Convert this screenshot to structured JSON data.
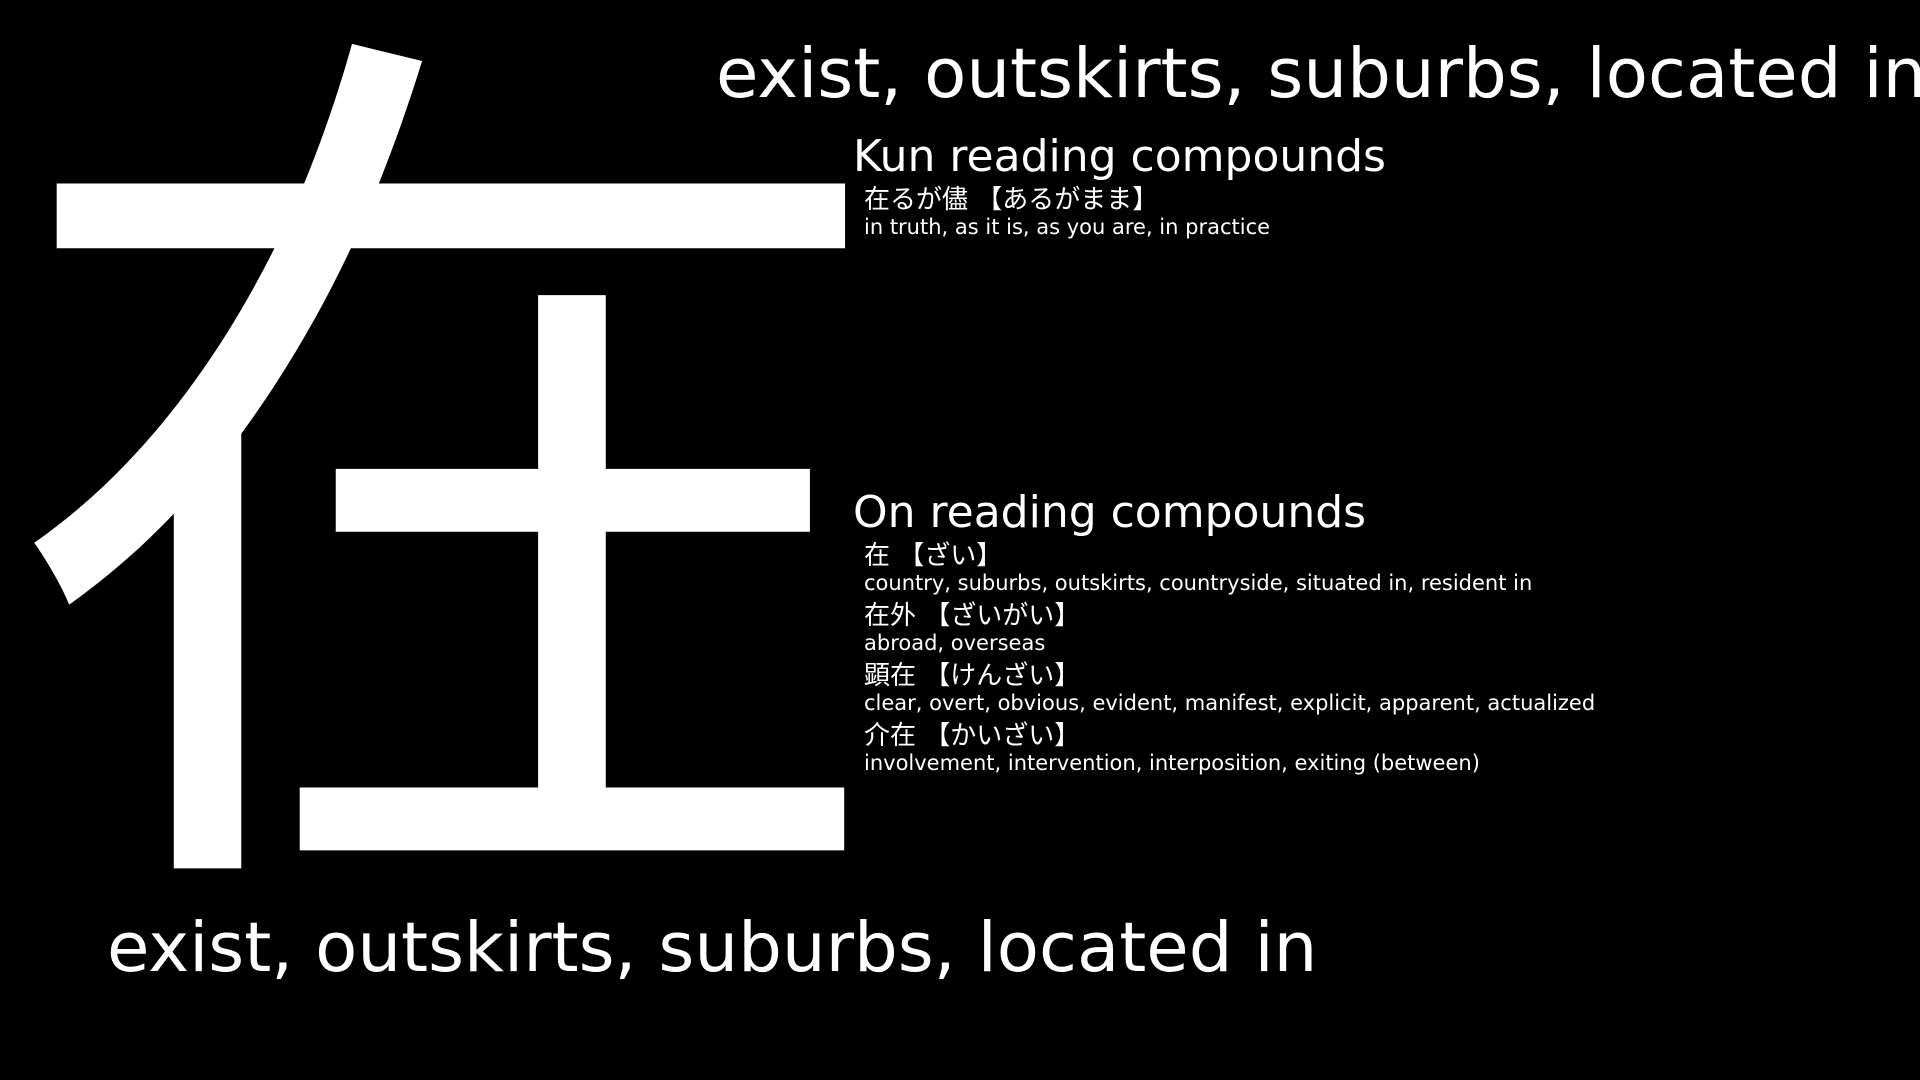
{
  "kanji": "在",
  "meaning": "exist, outskirts, suburbs, located in",
  "kun": {
    "heading": "Kun reading compounds",
    "items": [
      {
        "term": "在るが儘 【あるがまま】",
        "gloss": "in truth, as it is, as you are, in practice"
      }
    ]
  },
  "on": {
    "heading": "On reading compounds",
    "items": [
      {
        "term": "在 【ざい】",
        "gloss": "country, suburbs, outskirts, countryside, situated in, resident in"
      },
      {
        "term": "在外 【ざいがい】",
        "gloss": "abroad, overseas"
      },
      {
        "term": "顕在 【けんざい】",
        "gloss": "clear, overt, obvious, evident, manifest, explicit, apparent, actualized"
      },
      {
        "term": "介在 【かいざい】",
        "gloss": "involvement, intervention, interposition, exiting (between)"
      }
    ]
  }
}
